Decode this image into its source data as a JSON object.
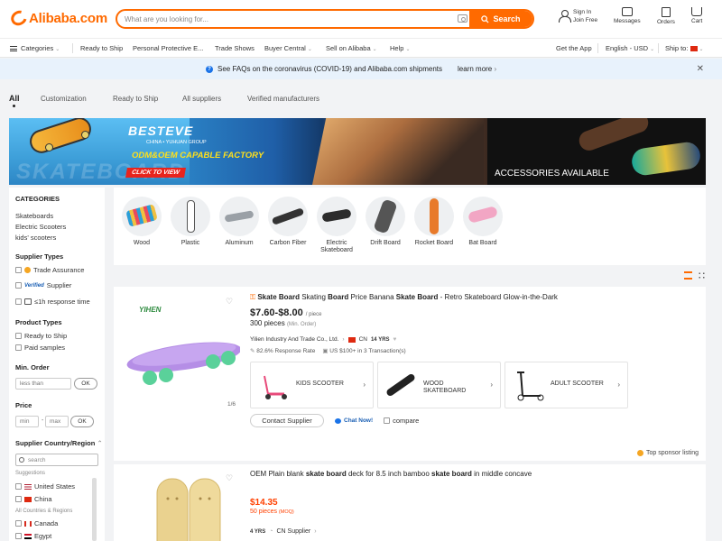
{
  "header": {
    "logo_text": "Alibaba.com",
    "search_placeholder": "What are you looking for...",
    "search_button": "Search",
    "sign_in": "Sign In",
    "join_free": "Join Free",
    "messages": "Messages",
    "orders": "Orders",
    "cart": "Cart"
  },
  "nav": {
    "categories": "Categories",
    "items": [
      "Ready to Ship",
      "Personal Protective E...",
      "Trade Shows",
      "Buyer Central",
      "Sell on Alibaba",
      "Help"
    ],
    "get_app": "Get the App",
    "language": "English - USD",
    "ship_to": "Ship to:"
  },
  "notice": {
    "text": "See FAQs on the coronavirus (COVID-19) and Alibaba.com shipments",
    "learn_more": "learn more"
  },
  "tabs": [
    "All",
    "Customization",
    "Ready to Ship",
    "All suppliers",
    "Verified manufacturers"
  ],
  "banner": {
    "brand": "BESTEVE",
    "sub": "CHINA • YUHUAN GROUP",
    "headline": "ODM&OEM CAPABLE FACTORY",
    "cta": "CLICK TO VIEW",
    "watermark": "SKATEBOARD",
    "accessories": "ACCESSORIES AVAILABLE"
  },
  "sidebar": {
    "categories_title": "CATEGORIES",
    "categories": [
      "Skateboards",
      "Electric Scooters",
      "kids' scooters"
    ],
    "supplier_types_title": "Supplier Types",
    "trade_assurance": "Trade Assurance",
    "verified_badge": "Verified",
    "verified_supplier": "Supplier",
    "response_time": "≤1h response time",
    "product_types_title": "Product Types",
    "ready_to_ship": "Ready to Ship",
    "paid_samples": "Paid samples",
    "min_order_title": "Min. Order",
    "less_than": "less than",
    "ok": "OK",
    "price_title": "Price",
    "min": "min",
    "dash": "-",
    "max": "max",
    "country_title": "Supplier Country/Region",
    "search_placeholder": "search",
    "suggestions": "Suggestions",
    "all_countries": "All Countries & Regions",
    "countries": [
      "United States",
      "China",
      "Canada",
      "Egypt"
    ]
  },
  "categories": [
    {
      "label": "Wood",
      "color": "#2a9fd8"
    },
    {
      "label": "Plastic",
      "color": "#ffffff"
    },
    {
      "label": "Aluminum",
      "color": "#bfc3c7"
    },
    {
      "label": "Carbon Fiber",
      "color": "#3a3a3a"
    },
    {
      "label": "Electric Skateboard",
      "color": "#2c2c2c"
    },
    {
      "label": "Drift Board",
      "color": "#555555"
    },
    {
      "label": "Rocket Board",
      "color": "#e87a2a"
    },
    {
      "label": "Bat Board",
      "color": "#f2a6c4"
    }
  ],
  "product1": {
    "title_parts": [
      {
        "text": "Skate Board",
        "b": true
      },
      {
        "text": " Skating ",
        "b": false
      },
      {
        "text": "Board",
        "b": true
      },
      {
        "text": " Price Banana ",
        "b": false
      },
      {
        "text": "Skate Board",
        "b": true
      },
      {
        "text": " - Retro Skateboard Glow-in-the-Dark",
        "b": false
      }
    ],
    "price": "$7.60-$8.00",
    "price_unit": "/ piece",
    "moq": "300 pieces",
    "moq_note": "(Min. Order)",
    "supplier": "Yilien Industry And Trade Co., Ltd.",
    "country": "CN",
    "years": "14 YRS",
    "response_rate": "82.6% Response Rate",
    "transactions": "US $100+ in 3 Transaction(s)",
    "related": [
      "KIDS SCOOTER",
      "WOOD SKATEBOARD",
      "ADULT SCOOTER"
    ],
    "contact": "Contact Supplier",
    "chat": "Chat Now!",
    "compare": "compare",
    "image_count": "1/6",
    "sponsor": "Top sponsor listing",
    "logo_text": "YIHEN"
  },
  "product2": {
    "title_parts": [
      {
        "text": "OEM Plain blank ",
        "b": false
      },
      {
        "text": "skate board",
        "b": true
      },
      {
        "text": " deck for 8.5 inch bamboo ",
        "b": false
      },
      {
        "text": "skate board",
        "b": true
      },
      {
        "text": " in middle concave",
        "b": false
      }
    ],
    "price": "$14.35",
    "moq": "50 pieces",
    "moq_note": "(MOQ)",
    "years": "4 YRS",
    "supplier": "CN Supplier"
  },
  "colors": {
    "brand": "#ff6a00",
    "link_blue": "#1a5fb4",
    "price_red": "#ff4000"
  }
}
